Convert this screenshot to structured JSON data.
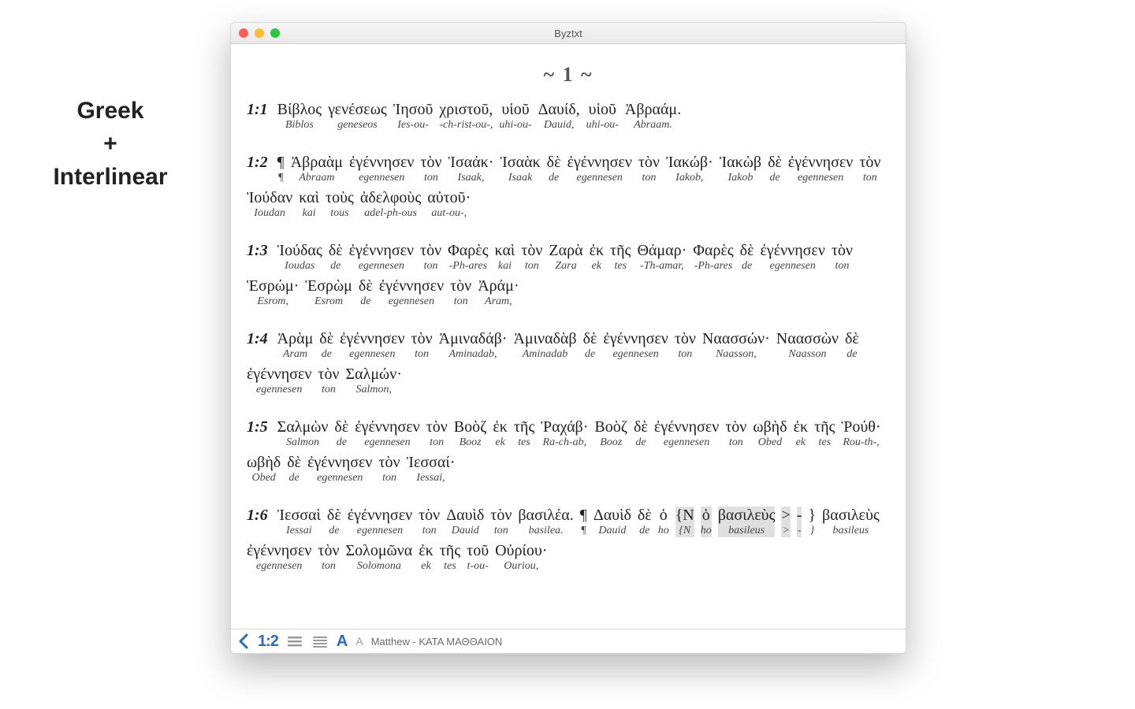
{
  "sideLabel": {
    "line1": "Greek",
    "line2": "+",
    "line3": "Interlinear"
  },
  "window": {
    "title": "Byztxt"
  },
  "toolbar": {
    "verseNumIcon": "1:2",
    "fontLarge": "A",
    "fontSmall": "A",
    "bookLabel": "Matthew - ΚΑΤΑ ΜΑΘΘΑΙΟΝ"
  },
  "document": {
    "chapterHeading": "~ 1 ~",
    "verses": [
      {
        "ref": "1:1",
        "words": [
          {
            "g": "Βίβλος",
            "t": "Biblos"
          },
          {
            "g": "γενέσεως",
            "t": "geneseos"
          },
          {
            "g": "Ἰησοῦ",
            "t": "Ies-ou-"
          },
          {
            "g": "χριστοῦ,",
            "t": "-ch-rist-ou-,"
          },
          {
            "g": "υἱοῦ",
            "t": "uhi-ou-"
          },
          {
            "g": "Δαυίδ,",
            "t": "Dauid,"
          },
          {
            "g": "υἱοῦ",
            "t": "uhi-ou-"
          },
          {
            "g": "Ἀβραάμ.",
            "t": "Abraam."
          }
        ]
      },
      {
        "ref": "1:2",
        "words": [
          {
            "g": "¶",
            "t": "¶"
          },
          {
            "g": "Ἀβραὰμ",
            "t": "Abraam"
          },
          {
            "g": "ἐγέννησεν",
            "t": "egennesen"
          },
          {
            "g": "τὸν",
            "t": "ton"
          },
          {
            "g": "Ἰσαάκ·",
            "t": "Isaak,"
          },
          {
            "g": "Ἰσαὰκ",
            "t": "Isaak"
          },
          {
            "g": "δὲ",
            "t": "de"
          },
          {
            "g": "ἐγέννησεν",
            "t": "egennesen"
          },
          {
            "g": "τὸν",
            "t": "ton"
          },
          {
            "g": "Ἰακώβ·",
            "t": "Iakob,"
          },
          {
            "g": "Ἰακὼβ",
            "t": "Iakob"
          },
          {
            "g": "δὲ",
            "t": "de"
          },
          {
            "g": "ἐγέννησεν",
            "t": "egennesen"
          },
          {
            "g": "τὸν",
            "t": "ton"
          },
          {
            "g": "Ἰούδαν",
            "t": "Ioudan"
          },
          {
            "g": "καὶ",
            "t": "kai"
          },
          {
            "g": "τοὺς",
            "t": "tous"
          },
          {
            "g": "ἀδελφοὺς",
            "t": "adel-ph-ous"
          },
          {
            "g": "αὐτοῦ·",
            "t": "aut-ou-,"
          }
        ]
      },
      {
        "ref": "1:3",
        "words": [
          {
            "g": "Ἰούδας",
            "t": "Ioudas"
          },
          {
            "g": "δὲ",
            "t": "de"
          },
          {
            "g": "ἐγέννησεν",
            "t": "egennesen"
          },
          {
            "g": "τὸν",
            "t": "ton"
          },
          {
            "g": "Φαρὲς",
            "t": "-Ph-ares"
          },
          {
            "g": "καὶ",
            "t": "kai"
          },
          {
            "g": "τὸν",
            "t": "ton"
          },
          {
            "g": "Ζαρὰ",
            "t": "Zara"
          },
          {
            "g": "ἐκ",
            "t": "ek"
          },
          {
            "g": "τῆς",
            "t": "tes"
          },
          {
            "g": "Θάμαρ·",
            "t": "-Th-amar,"
          },
          {
            "g": "Φαρὲς",
            "t": "-Ph-ares"
          },
          {
            "g": "δὲ",
            "t": "de"
          },
          {
            "g": "ἐγέννησεν",
            "t": "egennesen"
          },
          {
            "g": "τὸν",
            "t": "ton"
          },
          {
            "g": "Ἑσρώμ·",
            "t": "Esrom,"
          },
          {
            "g": "Ἑσρὼμ",
            "t": "Esrom"
          },
          {
            "g": "δὲ",
            "t": "de"
          },
          {
            "g": "ἐγέννησεν",
            "t": "egennesen"
          },
          {
            "g": "τὸν",
            "t": "ton"
          },
          {
            "g": "Ἀράμ·",
            "t": "Aram,"
          }
        ]
      },
      {
        "ref": "1:4",
        "words": [
          {
            "g": "Ἀρὰμ",
            "t": "Aram"
          },
          {
            "g": "δὲ",
            "t": "de"
          },
          {
            "g": "ἐγέννησεν",
            "t": "egennesen"
          },
          {
            "g": "τὸν",
            "t": "ton"
          },
          {
            "g": "Ἀμιναδάβ·",
            "t": "Aminadab,"
          },
          {
            "g": "Ἀμιναδὰβ",
            "t": "Aminadab"
          },
          {
            "g": "δὲ",
            "t": "de"
          },
          {
            "g": "ἐγέννησεν",
            "t": "egennesen"
          },
          {
            "g": "τὸν",
            "t": "ton"
          },
          {
            "g": "Ναασσών·",
            "t": "Naasson,"
          },
          {
            "g": "Ναασσὼν",
            "t": "Naasson"
          },
          {
            "g": "δὲ",
            "t": "de"
          },
          {
            "g": "ἐγέννησεν",
            "t": "egennesen"
          },
          {
            "g": "τὸν",
            "t": "ton"
          },
          {
            "g": "Σαλμών·",
            "t": "Salmon,"
          }
        ]
      },
      {
        "ref": "1:5",
        "words": [
          {
            "g": "Σαλμὼν",
            "t": "Salmon"
          },
          {
            "g": "δὲ",
            "t": "de"
          },
          {
            "g": "ἐγέννησεν",
            "t": "egennesen"
          },
          {
            "g": "τὸν",
            "t": "ton"
          },
          {
            "g": "Βοὸζ",
            "t": "Booz"
          },
          {
            "g": "ἐκ",
            "t": "ek"
          },
          {
            "g": "τῆς",
            "t": "tes"
          },
          {
            "g": "Ῥαχάβ·",
            "t": "Ra-ch-ab,"
          },
          {
            "g": "Βοὸζ",
            "t": "Booz"
          },
          {
            "g": "δὲ",
            "t": "de"
          },
          {
            "g": "ἐγέννησεν",
            "t": "egennesen"
          },
          {
            "g": "τὸν",
            "t": "ton"
          },
          {
            "g": "ωβὴδ",
            "t": "Obed"
          },
          {
            "g": "ἐκ",
            "t": "ek"
          },
          {
            "g": "τῆς",
            "t": "tes"
          },
          {
            "g": "Ῥούθ·",
            "t": "Rou-th-,"
          },
          {
            "g": "ωβὴδ",
            "t": "Obed"
          },
          {
            "g": "δὲ",
            "t": "de"
          },
          {
            "g": "ἐγέννησεν",
            "t": "egennesen"
          },
          {
            "g": "τὸν",
            "t": "ton"
          },
          {
            "g": "Ἰεσσαί·",
            "t": "Iessai,"
          }
        ]
      },
      {
        "ref": "1:6",
        "words": [
          {
            "g": "Ἰεσσαὶ",
            "t": "Iessai"
          },
          {
            "g": "δὲ",
            "t": "de"
          },
          {
            "g": "ἐγέννησεν",
            "t": "egennesen"
          },
          {
            "g": "τὸν",
            "t": "ton"
          },
          {
            "g": "Δαυὶδ",
            "t": "Dauid"
          },
          {
            "g": "τὸν",
            "t": "ton"
          },
          {
            "g": "βασιλέα.",
            "t": "basilea."
          },
          {
            "g": "¶",
            "t": "¶"
          },
          {
            "g": "Δαυὶδ",
            "t": "Dauid"
          },
          {
            "g": "δὲ",
            "t": "de"
          },
          {
            "g": "ὁ",
            "t": "ho"
          },
          {
            "g": "{N",
            "t": "{N",
            "hl": true
          },
          {
            "g": "ὁ",
            "t": "ho",
            "hl": true
          },
          {
            "g": "βασιλεὺς",
            "t": "basileus",
            "hl": true
          },
          {
            "g": ">",
            "t": ">",
            "hl": true
          },
          {
            "g": "-",
            "t": "-",
            "hl": true
          },
          {
            "g": "}",
            "t": "}"
          },
          {
            "g": "βασιλεὺς",
            "t": "basileus"
          },
          {
            "g": "ἐγέννησεν",
            "t": "egennesen"
          },
          {
            "g": "τὸν",
            "t": "ton"
          },
          {
            "g": "Σολομῶνα",
            "t": "Solomona"
          },
          {
            "g": "ἐκ",
            "t": "ek"
          },
          {
            "g": "τῆς",
            "t": "tes"
          },
          {
            "g": "τοῦ",
            "t": "t-ou-"
          },
          {
            "g": "Οὐρίου·",
            "t": "Ouriou,"
          }
        ]
      }
    ]
  }
}
